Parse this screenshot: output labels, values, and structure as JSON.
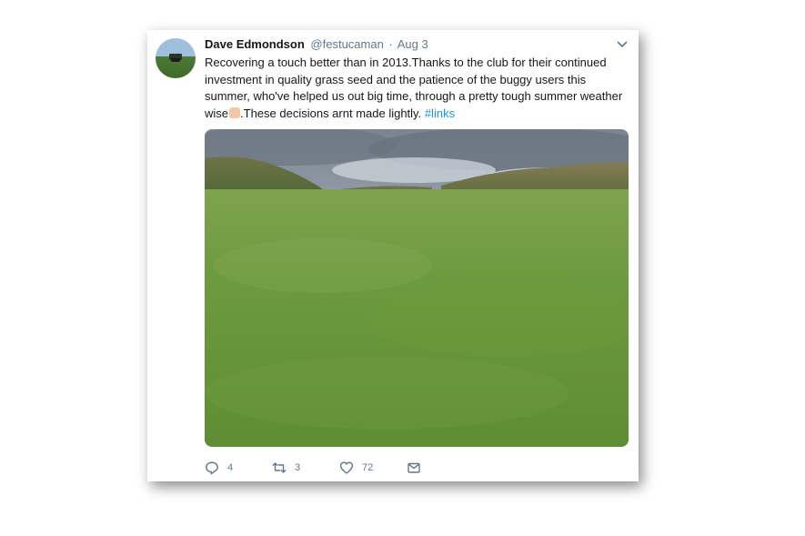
{
  "tweet": {
    "display_name": "Dave Edmondson",
    "handle": "@festucaman",
    "separator": "·",
    "date": "Aug 3",
    "text_before_emoji": "Recovering a touch better than in 2013.Thanks to the club for their continued investment in quality grass seed and the patience of the buggy users this summer, who've helped us out big time, through a pretty tough summer weather wise",
    "emoji": "thumbs-up-emoji",
    "text_after_emoji": ".These decisions arnt made lightly. ",
    "hashtag": "#links",
    "reply_count": "4",
    "retweet_count": "3",
    "like_count": "72"
  },
  "icons": {
    "more": "chevron-down-icon",
    "reply": "reply-icon",
    "retweet": "retweet-icon",
    "like": "heart-icon",
    "dm": "envelope-icon"
  },
  "colors": {
    "text": "#14171a",
    "secondary": "#657786",
    "link": "#1b95e0"
  }
}
